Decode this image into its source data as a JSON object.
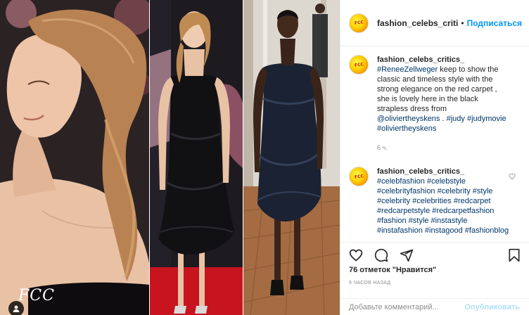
{
  "media": {
    "watermark": "FCC",
    "panels": [
      "portrait-profile",
      "red-carpet-full-length",
      "runway-model"
    ]
  },
  "header": {
    "username": "fashion_celebs_criti",
    "dot": "•",
    "follow_label": "Подписаться",
    "avatar_text": "FCC"
  },
  "comments": [
    {
      "username": "fashion_celebs_critics_",
      "segments": [
        {
          "text": "#ReneeZellweger",
          "tag": true
        },
        {
          "text": " keep to show the classic and timeless style with the strong elegance on the red carpet , she is lovely here in the black strapless dress from ",
          "tag": false
        },
        {
          "text": "@oliviertheyskens",
          "tag": true
        },
        {
          "text": " . ",
          "tag": false
        },
        {
          "text": "#judy",
          "tag": true
        },
        {
          "text": " ",
          "tag": false
        },
        {
          "text": "#judymovie",
          "tag": true
        },
        {
          "text": " ",
          "tag": false
        },
        {
          "text": "#oliviertheyskens",
          "tag": true
        }
      ],
      "time": "6 ч."
    },
    {
      "username": "fashion_celebs_critics_",
      "tags": [
        "#celebfashion",
        "#celebstyle",
        "#celebrityfashion",
        "#celebrity",
        "#style",
        "#celebrity",
        "#celebrities",
        "#redcarpet",
        "#redcarpetstyle",
        "#redcarpetfashion",
        "#fashion",
        "#style",
        "#instastyle",
        "#instafashion",
        "#instagood",
        "#fashionblog"
      ]
    }
  ],
  "likes_text": "76 отметок \"Нравится\"",
  "timestamp": "6 ЧАСОВ НАЗАД",
  "comment_box": {
    "placeholder": "Добавьте комментарий...",
    "publish_label": "Опубликовать"
  },
  "colors": {
    "link": "#0095f6",
    "tag": "#00376b",
    "muted": "#8e8e8e",
    "publish_disabled": "#b2dffc"
  },
  "icons": [
    "heart-icon",
    "comment-icon",
    "share-icon",
    "bookmark-icon",
    "user-tag-icon",
    "small-heart-icon"
  ]
}
